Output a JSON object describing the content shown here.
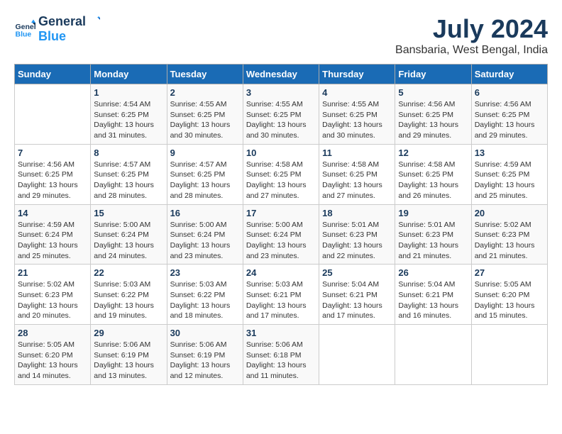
{
  "header": {
    "logo_line1": "General",
    "logo_line2": "Blue",
    "month": "July 2024",
    "location": "Bansbaria, West Bengal, India"
  },
  "weekdays": [
    "Sunday",
    "Monday",
    "Tuesday",
    "Wednesday",
    "Thursday",
    "Friday",
    "Saturday"
  ],
  "weeks": [
    [
      {
        "day": "",
        "info": ""
      },
      {
        "day": "1",
        "info": "Sunrise: 4:54 AM\nSunset: 6:25 PM\nDaylight: 13 hours\nand 31 minutes."
      },
      {
        "day": "2",
        "info": "Sunrise: 4:55 AM\nSunset: 6:25 PM\nDaylight: 13 hours\nand 30 minutes."
      },
      {
        "day": "3",
        "info": "Sunrise: 4:55 AM\nSunset: 6:25 PM\nDaylight: 13 hours\nand 30 minutes."
      },
      {
        "day": "4",
        "info": "Sunrise: 4:55 AM\nSunset: 6:25 PM\nDaylight: 13 hours\nand 30 minutes."
      },
      {
        "day": "5",
        "info": "Sunrise: 4:56 AM\nSunset: 6:25 PM\nDaylight: 13 hours\nand 29 minutes."
      },
      {
        "day": "6",
        "info": "Sunrise: 4:56 AM\nSunset: 6:25 PM\nDaylight: 13 hours\nand 29 minutes."
      }
    ],
    [
      {
        "day": "7",
        "info": "Sunrise: 4:56 AM\nSunset: 6:25 PM\nDaylight: 13 hours\nand 29 minutes."
      },
      {
        "day": "8",
        "info": "Sunrise: 4:57 AM\nSunset: 6:25 PM\nDaylight: 13 hours\nand 28 minutes."
      },
      {
        "day": "9",
        "info": "Sunrise: 4:57 AM\nSunset: 6:25 PM\nDaylight: 13 hours\nand 28 minutes."
      },
      {
        "day": "10",
        "info": "Sunrise: 4:58 AM\nSunset: 6:25 PM\nDaylight: 13 hours\nand 27 minutes."
      },
      {
        "day": "11",
        "info": "Sunrise: 4:58 AM\nSunset: 6:25 PM\nDaylight: 13 hours\nand 27 minutes."
      },
      {
        "day": "12",
        "info": "Sunrise: 4:58 AM\nSunset: 6:25 PM\nDaylight: 13 hours\nand 26 minutes."
      },
      {
        "day": "13",
        "info": "Sunrise: 4:59 AM\nSunset: 6:25 PM\nDaylight: 13 hours\nand 25 minutes."
      }
    ],
    [
      {
        "day": "14",
        "info": "Sunrise: 4:59 AM\nSunset: 6:24 PM\nDaylight: 13 hours\nand 25 minutes."
      },
      {
        "day": "15",
        "info": "Sunrise: 5:00 AM\nSunset: 6:24 PM\nDaylight: 13 hours\nand 24 minutes."
      },
      {
        "day": "16",
        "info": "Sunrise: 5:00 AM\nSunset: 6:24 PM\nDaylight: 13 hours\nand 23 minutes."
      },
      {
        "day": "17",
        "info": "Sunrise: 5:00 AM\nSunset: 6:24 PM\nDaylight: 13 hours\nand 23 minutes."
      },
      {
        "day": "18",
        "info": "Sunrise: 5:01 AM\nSunset: 6:23 PM\nDaylight: 13 hours\nand 22 minutes."
      },
      {
        "day": "19",
        "info": "Sunrise: 5:01 AM\nSunset: 6:23 PM\nDaylight: 13 hours\nand 21 minutes."
      },
      {
        "day": "20",
        "info": "Sunrise: 5:02 AM\nSunset: 6:23 PM\nDaylight: 13 hours\nand 21 minutes."
      }
    ],
    [
      {
        "day": "21",
        "info": "Sunrise: 5:02 AM\nSunset: 6:23 PM\nDaylight: 13 hours\nand 20 minutes."
      },
      {
        "day": "22",
        "info": "Sunrise: 5:03 AM\nSunset: 6:22 PM\nDaylight: 13 hours\nand 19 minutes."
      },
      {
        "day": "23",
        "info": "Sunrise: 5:03 AM\nSunset: 6:22 PM\nDaylight: 13 hours\nand 18 minutes."
      },
      {
        "day": "24",
        "info": "Sunrise: 5:03 AM\nSunset: 6:21 PM\nDaylight: 13 hours\nand 17 minutes."
      },
      {
        "day": "25",
        "info": "Sunrise: 5:04 AM\nSunset: 6:21 PM\nDaylight: 13 hours\nand 17 minutes."
      },
      {
        "day": "26",
        "info": "Sunrise: 5:04 AM\nSunset: 6:21 PM\nDaylight: 13 hours\nand 16 minutes."
      },
      {
        "day": "27",
        "info": "Sunrise: 5:05 AM\nSunset: 6:20 PM\nDaylight: 13 hours\nand 15 minutes."
      }
    ],
    [
      {
        "day": "28",
        "info": "Sunrise: 5:05 AM\nSunset: 6:20 PM\nDaylight: 13 hours\nand 14 minutes."
      },
      {
        "day": "29",
        "info": "Sunrise: 5:06 AM\nSunset: 6:19 PM\nDaylight: 13 hours\nand 13 minutes."
      },
      {
        "day": "30",
        "info": "Sunrise: 5:06 AM\nSunset: 6:19 PM\nDaylight: 13 hours\nand 12 minutes."
      },
      {
        "day": "31",
        "info": "Sunrise: 5:06 AM\nSunset: 6:18 PM\nDaylight: 13 hours\nand 11 minutes."
      },
      {
        "day": "",
        "info": ""
      },
      {
        "day": "",
        "info": ""
      },
      {
        "day": "",
        "info": ""
      }
    ]
  ]
}
